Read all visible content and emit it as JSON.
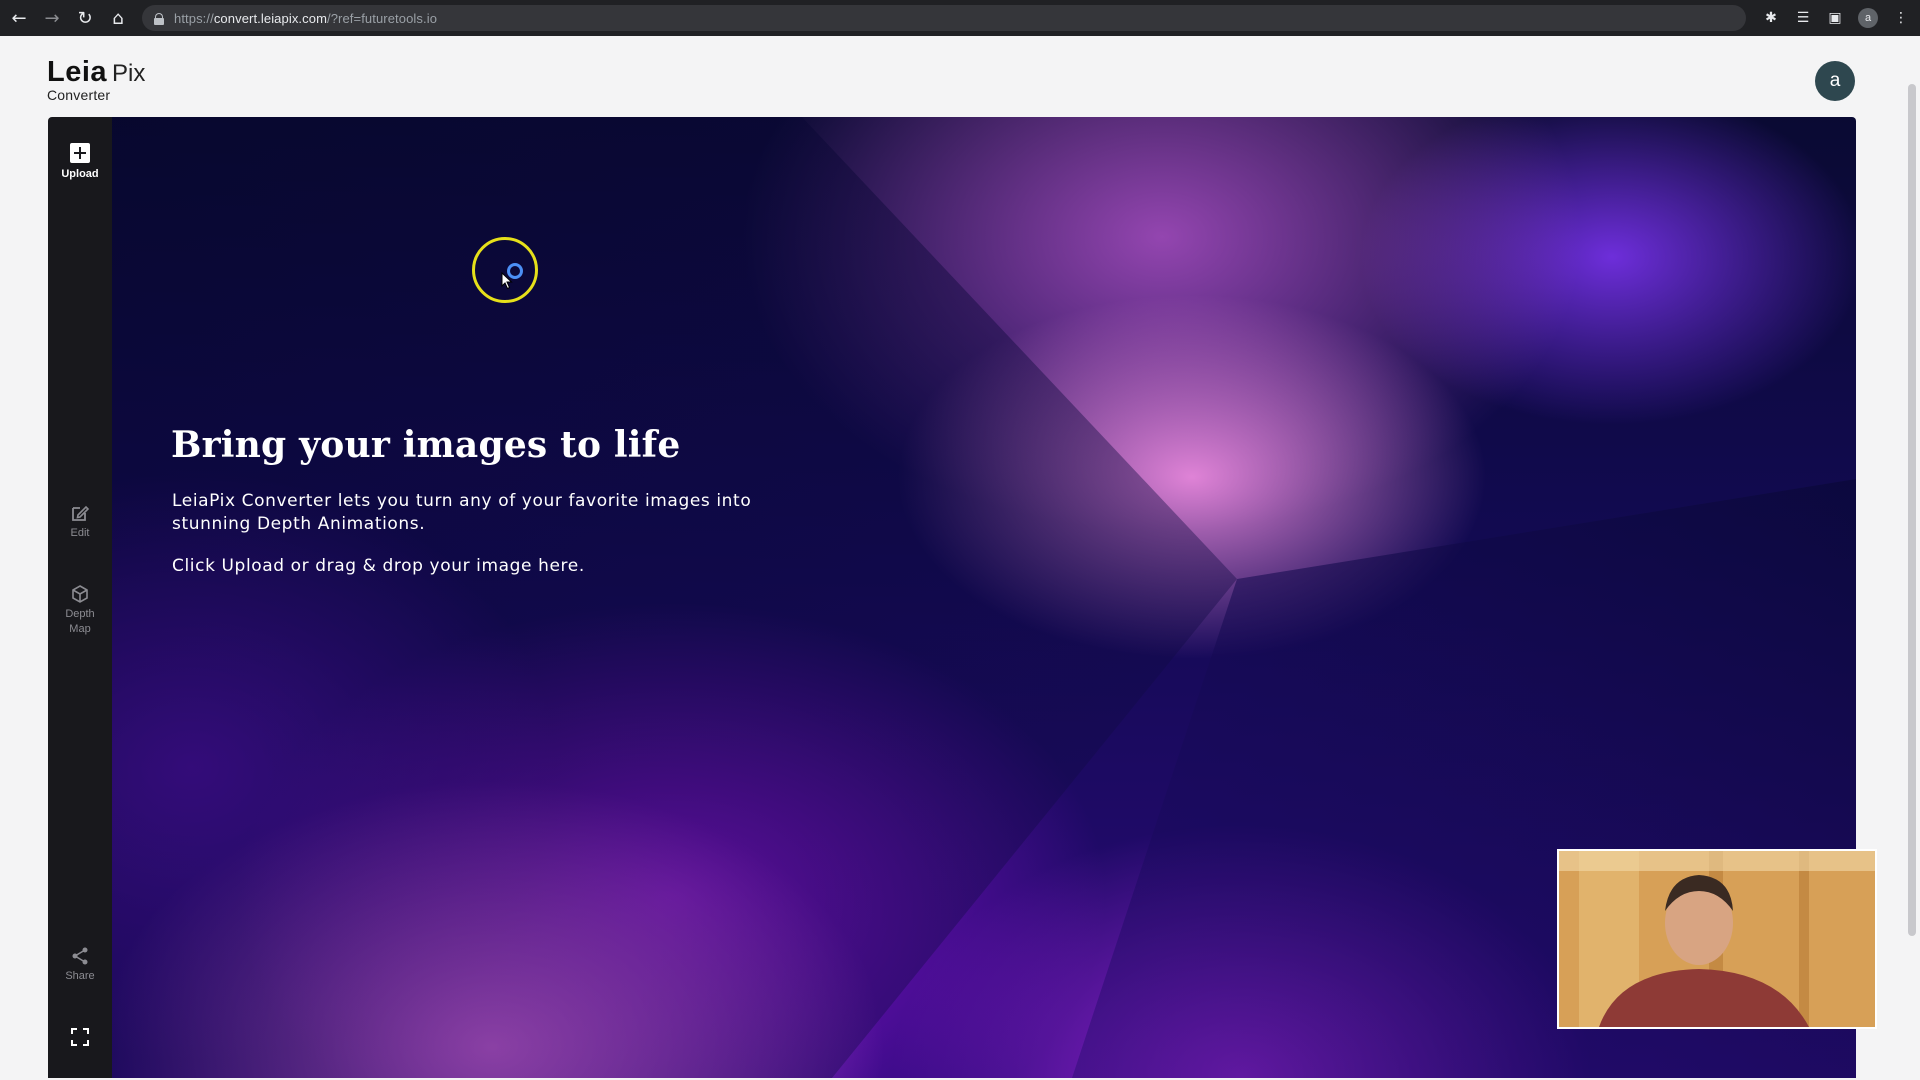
{
  "browser": {
    "url_scheme": "https://",
    "url_host": "convert.leiapix.com",
    "url_path": "/?ref=futuretools.io",
    "profile_initial": "a"
  },
  "header": {
    "logo_primary": "Leia",
    "logo_secondary": "Pix",
    "logo_subtitle": "Converter",
    "user_initial": "a"
  },
  "sidebar": {
    "upload": "Upload",
    "edit": "Edit",
    "depth_map_line1": "Depth",
    "depth_map_line2": "Map",
    "share": "Share"
  },
  "hero": {
    "title": "Bring your images to life",
    "description": "LeiaPix Converter lets you turn any of your favorite images into stunning Depth Animations.",
    "hint": "Click Upload or drag & drop your image here."
  },
  "colors": {
    "sidebar_bg": "#18181c",
    "avatar_bg": "#2e474f",
    "cursor_ring": "#e6e01a",
    "cursor_dot": "#4c8ff5"
  },
  "icons": [
    "back-arrow-icon",
    "forward-arrow-icon",
    "reload-icon",
    "home-icon",
    "lock-icon",
    "extensions-icon",
    "reading-list-icon",
    "side-panel-icon",
    "kebab-menu-icon",
    "plus-icon",
    "edit-icon",
    "depth-map-icon",
    "share-icon",
    "fullscreen-icon"
  ]
}
